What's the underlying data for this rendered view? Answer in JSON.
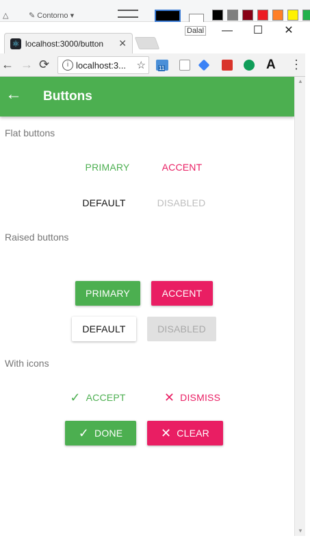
{
  "paint": {
    "contour_label": "Contorno",
    "colors": [
      "#000000",
      "#7f7f7f",
      "#880015",
      "#ed1c24",
      "#ff7f27",
      "#fff200"
    ]
  },
  "window": {
    "profile_label": "Dalal",
    "minimize": "—",
    "maximize": "☐",
    "close": "✕"
  },
  "tab": {
    "title": "localhost:3000/button",
    "close": "✕",
    "favicon": "⚛"
  },
  "omnibox": {
    "text": "localhost:3...",
    "info": "i",
    "star": "☆"
  },
  "nav": {
    "back": "←",
    "forward": "→",
    "reload": "⟳",
    "menu": "⋮"
  },
  "ext": {
    "badge": "11",
    "font_letter": "A"
  },
  "appbar": {
    "back": "←",
    "title": "Buttons",
    "color": "#4caf50"
  },
  "sections": {
    "flat": "Flat buttons",
    "raised": "Raised buttons",
    "icons": "With icons"
  },
  "flat": {
    "primary": "PRIMARY",
    "accent": "ACCENT",
    "default": "DEFAULT",
    "disabled": "DISABLED"
  },
  "raised": {
    "primary": "PRIMARY",
    "accent": "ACCENT",
    "default": "DEFAULT",
    "disabled": "DISABLED"
  },
  "icons": {
    "accept": "ACCEPT",
    "dismiss": "DISMISS",
    "done": "DONE",
    "clear": "CLEAR",
    "check_glyph": "✓",
    "x_glyph": "✕"
  },
  "theme": {
    "primary": "#4caf50",
    "accent": "#e91e63",
    "disabled_text": "#bdbdbd",
    "disabled_bg": "#e0e0e0"
  }
}
